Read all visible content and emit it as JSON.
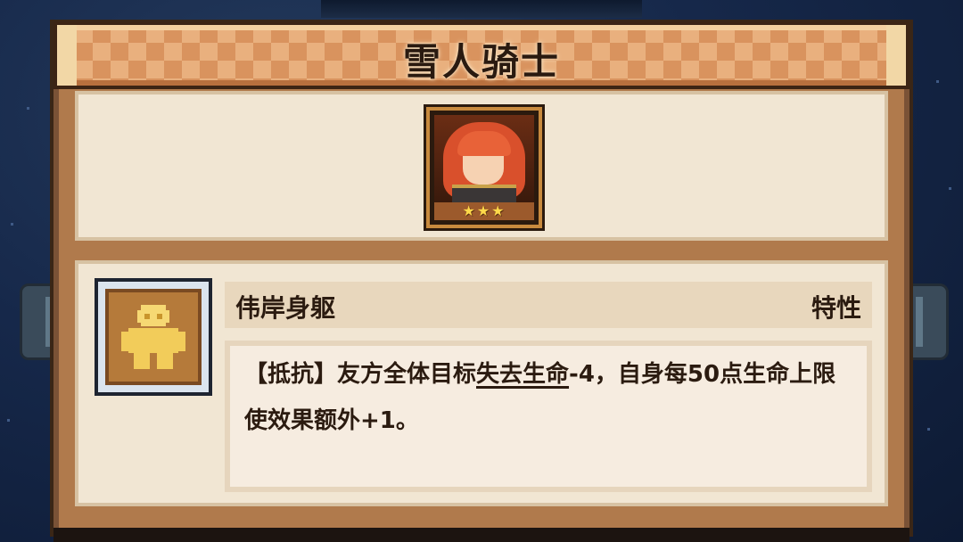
{
  "title": "雪人骑士",
  "character": {
    "portrait_icon": "character-portrait",
    "stars": "★★★",
    "star_count": 3
  },
  "trait": {
    "icon": "golem-figure-icon",
    "name": "伟岸身躯",
    "type": "特性",
    "description": {
      "seg1": "【抵抗】友方全体目标",
      "keyword": "失去生命",
      "seg2": "-4，自身每50点生命上限使效果额外+1。"
    }
  },
  "colors": {
    "panel_border": "#3a2616",
    "panel_wood": "#b07a4c",
    "title_orange": "#d9935e",
    "parchment": "#f1e6d3",
    "text_dark": "#2b1b10",
    "star_yellow": "#ffd94a",
    "trait_icon_gold": "#e9c25a"
  }
}
